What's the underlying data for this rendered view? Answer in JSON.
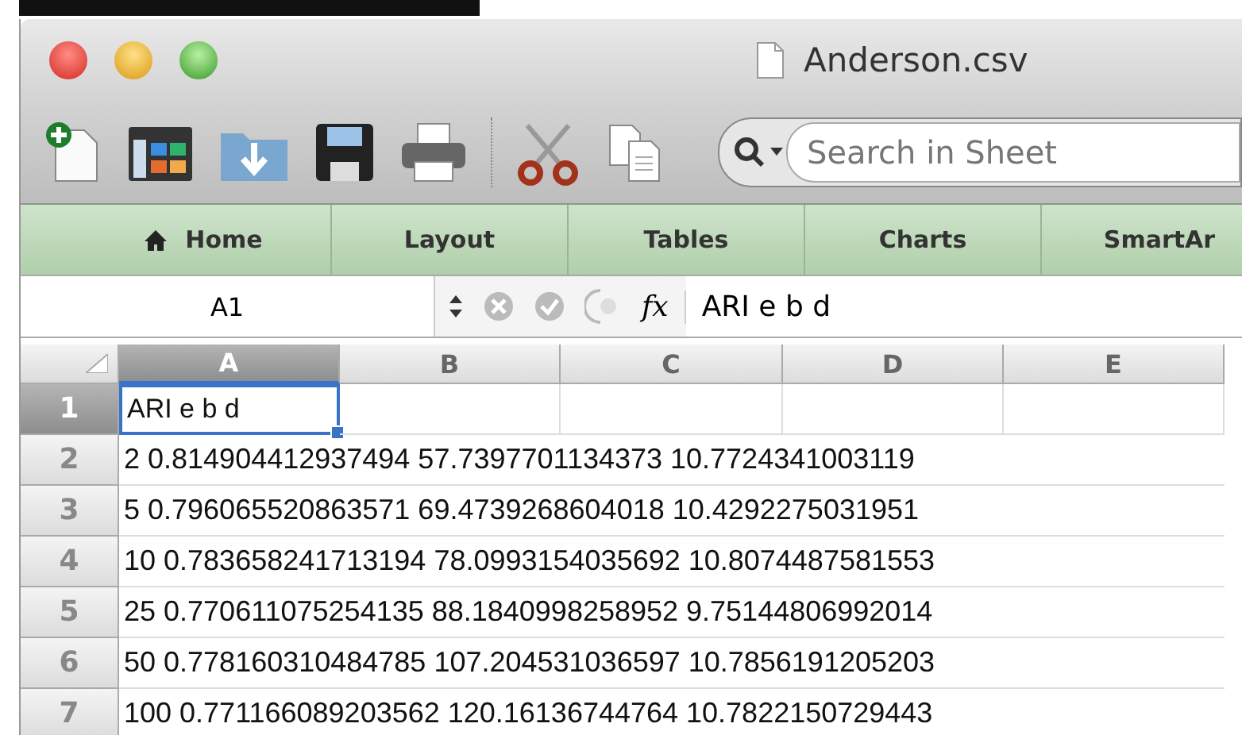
{
  "window": {
    "title": "Anderson.csv"
  },
  "toolbar": {
    "search": {
      "placeholder": "Search in Sheet"
    }
  },
  "ribbon_tabs": [
    {
      "label": "Home",
      "kind": "home"
    },
    {
      "label": "Layout",
      "kind": "plain"
    },
    {
      "label": "Tables",
      "kind": "plain"
    },
    {
      "label": "Charts",
      "kind": "plain"
    },
    {
      "label": "SmartAr",
      "kind": "plain"
    }
  ],
  "formula_bar": {
    "name_box": "A1",
    "function_label": "fx",
    "value": "ARI e b d"
  },
  "sheet": {
    "columns": [
      {
        "label": "A",
        "selected": true
      },
      {
        "label": "B",
        "selected": false
      },
      {
        "label": "C",
        "selected": false
      },
      {
        "label": "D",
        "selected": false
      },
      {
        "label": "E",
        "selected": false
      }
    ],
    "rows": [
      {
        "number": "1",
        "selected": true,
        "cell": "ARI e b d"
      },
      {
        "number": "2",
        "selected": false,
        "cell": "2 0.814904412937494 57.7397701134373 10.7724341003119"
      },
      {
        "number": "3",
        "selected": false,
        "cell": "5 0.796065520863571 69.4739268604018 10.4292275031951"
      },
      {
        "number": "4",
        "selected": false,
        "cell": "10 0.783658241713194 78.0993154035692 10.8074487581553"
      },
      {
        "number": "5",
        "selected": false,
        "cell": "25 0.770611075254135 88.1840998258952 9.75144806992014"
      },
      {
        "number": "6",
        "selected": false,
        "cell": "50 0.778160310484785 107.204531036597 10.7856191205203"
      },
      {
        "number": "7",
        "selected": false,
        "cell": "100 0.771166089203562 120.16136744764 10.7822150729443"
      }
    ]
  }
}
